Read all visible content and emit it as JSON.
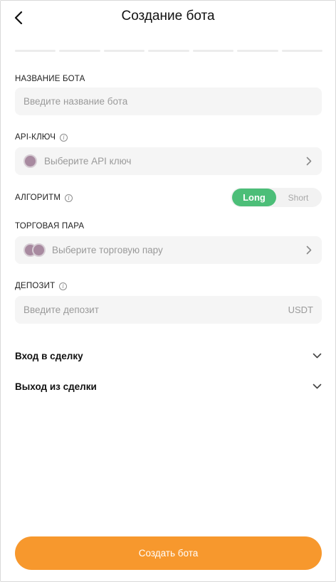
{
  "header": {
    "title": "Создание бота",
    "back_icon": "chevron-left-icon"
  },
  "progress": {
    "total_steps": 7,
    "current_step": 0
  },
  "form": {
    "bot_name": {
      "label": "НАЗВАНИЕ БОТА",
      "placeholder": "Введите название бота"
    },
    "api_key": {
      "label": "API-КЛЮЧ",
      "placeholder": "Выберите API ключ"
    },
    "algorithm": {
      "label": "АЛГОРИТМ",
      "options": [
        "Long",
        "Short"
      ],
      "selected": "Long"
    },
    "trading_pair": {
      "label": "ТОРГОВАЯ ПАРА",
      "placeholder": "Выберите торговую пару"
    },
    "deposit": {
      "label": "ДЕПОЗИТ",
      "placeholder": "Введите депозит",
      "currency": "USDT"
    }
  },
  "sections": {
    "entry": "Вход в сделку",
    "exit": "Выход из сделки"
  },
  "cta": {
    "label": "Создать бота"
  },
  "colors": {
    "accent": "#f7982d",
    "toggle_active": "#4cbe78",
    "field_bg": "#f5f5f5"
  }
}
